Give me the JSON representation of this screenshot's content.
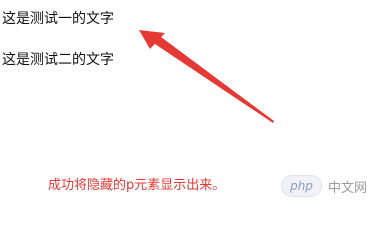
{
  "paragraphs": [
    {
      "text": "这是测试一的文字"
    },
    {
      "text": "这是测试二的文字"
    }
  ],
  "caption": {
    "text": "成功将隐藏的p元素显示出来。",
    "color": "#e53935"
  },
  "watermark": {
    "logo_text": "php",
    "site_text": "中文网"
  },
  "annotation": {
    "arrow_color": "#e53935"
  }
}
